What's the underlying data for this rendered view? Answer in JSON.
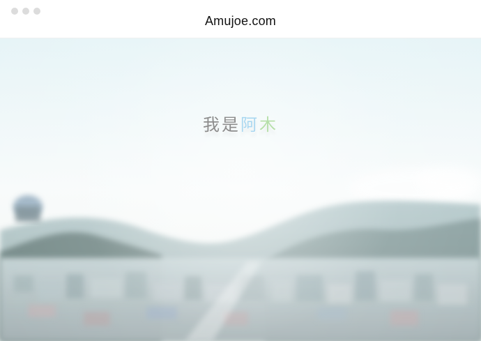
{
  "window": {
    "title": "Amujoe.com",
    "controls": [
      "dot",
      "dot",
      "dot"
    ]
  },
  "hero": {
    "headline_parts": [
      "我",
      "是",
      "阿",
      "木"
    ],
    "colors": {
      "gray": "#8c8c8c",
      "blue": "#a9d7f0",
      "green": "#b6dfaa"
    }
  }
}
